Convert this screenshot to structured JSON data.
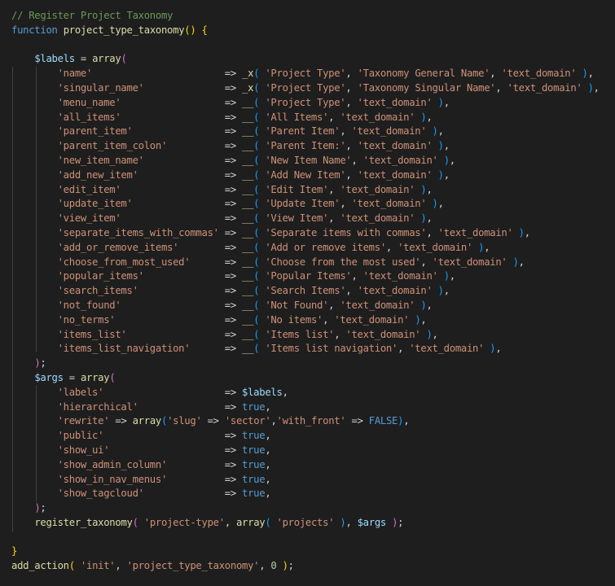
{
  "theme": {
    "background": "#1e1e1e",
    "colors": {
      "c": "#6a9955",
      "k": "#569cd6",
      "f": "#dcdcaa",
      "v": "#9cdcfe",
      "s": "#ce9178",
      "o": "#d4d4d4",
      "n": "#b5cea8",
      "y": "#ffd700",
      "m": "#da70d6",
      "b": "#179fff"
    }
  },
  "code_lines": [
    [
      [
        "c",
        "// Register Project Taxonomy"
      ]
    ],
    [
      [
        "k",
        "function "
      ],
      [
        "f",
        "project_type_taxonomy"
      ],
      [
        "y",
        "()"
      ],
      [
        "o",
        " "
      ],
      [
        "y",
        "{"
      ]
    ],
    [],
    [
      [
        "o",
        "    "
      ],
      [
        "v",
        "$labels"
      ],
      [
        "o",
        " = "
      ],
      [
        "f",
        "array"
      ],
      [
        "m",
        "("
      ]
    ],
    [
      [
        "o",
        "        "
      ],
      [
        "s",
        "'name'"
      ],
      [
        "o",
        "                       => "
      ],
      [
        "f",
        "_x"
      ],
      [
        "b",
        "("
      ],
      [
        "o",
        " "
      ],
      [
        "s",
        "'Project Type'"
      ],
      [
        "o",
        ", "
      ],
      [
        "s",
        "'Taxonomy General Name'"
      ],
      [
        "o",
        ", "
      ],
      [
        "s",
        "'text_domain'"
      ],
      [
        "o",
        " "
      ],
      [
        "b",
        ")"
      ],
      [
        "o",
        ","
      ]
    ],
    [
      [
        "o",
        "        "
      ],
      [
        "s",
        "'singular_name'"
      ],
      [
        "o",
        "              => "
      ],
      [
        "f",
        "_x"
      ],
      [
        "b",
        "("
      ],
      [
        "o",
        " "
      ],
      [
        "s",
        "'Project Type'"
      ],
      [
        "o",
        ", "
      ],
      [
        "s",
        "'Taxonomy Singular Name'"
      ],
      [
        "o",
        ", "
      ],
      [
        "s",
        "'text_domain'"
      ],
      [
        "o",
        " "
      ],
      [
        "b",
        ")"
      ],
      [
        "o",
        ","
      ]
    ],
    [
      [
        "o",
        "        "
      ],
      [
        "s",
        "'menu_name'"
      ],
      [
        "o",
        "                  => "
      ],
      [
        "f",
        "__"
      ],
      [
        "b",
        "("
      ],
      [
        "o",
        " "
      ],
      [
        "s",
        "'Project Type'"
      ],
      [
        "o",
        ", "
      ],
      [
        "s",
        "'text_domain'"
      ],
      [
        "o",
        " "
      ],
      [
        "b",
        ")"
      ],
      [
        "o",
        ","
      ]
    ],
    [
      [
        "o",
        "        "
      ],
      [
        "s",
        "'all_items'"
      ],
      [
        "o",
        "                  => "
      ],
      [
        "f",
        "__"
      ],
      [
        "b",
        "("
      ],
      [
        "o",
        " "
      ],
      [
        "s",
        "'All Items'"
      ],
      [
        "o",
        ", "
      ],
      [
        "s",
        "'text_domain'"
      ],
      [
        "o",
        " "
      ],
      [
        "b",
        ")"
      ],
      [
        "o",
        ","
      ]
    ],
    [
      [
        "o",
        "        "
      ],
      [
        "s",
        "'parent_item'"
      ],
      [
        "o",
        "                => "
      ],
      [
        "f",
        "__"
      ],
      [
        "b",
        "("
      ],
      [
        "o",
        " "
      ],
      [
        "s",
        "'Parent Item'"
      ],
      [
        "o",
        ", "
      ],
      [
        "s",
        "'text_domain'"
      ],
      [
        "o",
        " "
      ],
      [
        "b",
        ")"
      ],
      [
        "o",
        ","
      ]
    ],
    [
      [
        "o",
        "        "
      ],
      [
        "s",
        "'parent_item_colon'"
      ],
      [
        "o",
        "          => "
      ],
      [
        "f",
        "__"
      ],
      [
        "b",
        "("
      ],
      [
        "o",
        " "
      ],
      [
        "s",
        "'Parent Item:'"
      ],
      [
        "o",
        ", "
      ],
      [
        "s",
        "'text_domain'"
      ],
      [
        "o",
        " "
      ],
      [
        "b",
        ")"
      ],
      [
        "o",
        ","
      ]
    ],
    [
      [
        "o",
        "        "
      ],
      [
        "s",
        "'new_item_name'"
      ],
      [
        "o",
        "              => "
      ],
      [
        "f",
        "__"
      ],
      [
        "b",
        "("
      ],
      [
        "o",
        " "
      ],
      [
        "s",
        "'New Item Name'"
      ],
      [
        "o",
        ", "
      ],
      [
        "s",
        "'text_domain'"
      ],
      [
        "o",
        " "
      ],
      [
        "b",
        ")"
      ],
      [
        "o",
        ","
      ]
    ],
    [
      [
        "o",
        "        "
      ],
      [
        "s",
        "'add_new_item'"
      ],
      [
        "o",
        "               => "
      ],
      [
        "f",
        "__"
      ],
      [
        "b",
        "("
      ],
      [
        "o",
        " "
      ],
      [
        "s",
        "'Add New Item'"
      ],
      [
        "o",
        ", "
      ],
      [
        "s",
        "'text_domain'"
      ],
      [
        "o",
        " "
      ],
      [
        "b",
        ")"
      ],
      [
        "o",
        ","
      ]
    ],
    [
      [
        "o",
        "        "
      ],
      [
        "s",
        "'edit_item'"
      ],
      [
        "o",
        "                  => "
      ],
      [
        "f",
        "__"
      ],
      [
        "b",
        "("
      ],
      [
        "o",
        " "
      ],
      [
        "s",
        "'Edit Item'"
      ],
      [
        "o",
        ", "
      ],
      [
        "s",
        "'text_domain'"
      ],
      [
        "o",
        " "
      ],
      [
        "b",
        ")"
      ],
      [
        "o",
        ","
      ]
    ],
    [
      [
        "o",
        "        "
      ],
      [
        "s",
        "'update_item'"
      ],
      [
        "o",
        "                => "
      ],
      [
        "f",
        "__"
      ],
      [
        "b",
        "("
      ],
      [
        "o",
        " "
      ],
      [
        "s",
        "'Update Item'"
      ],
      [
        "o",
        ", "
      ],
      [
        "s",
        "'text_domain'"
      ],
      [
        "o",
        " "
      ],
      [
        "b",
        ")"
      ],
      [
        "o",
        ","
      ]
    ],
    [
      [
        "o",
        "        "
      ],
      [
        "s",
        "'view_item'"
      ],
      [
        "o",
        "                  => "
      ],
      [
        "f",
        "__"
      ],
      [
        "b",
        "("
      ],
      [
        "o",
        " "
      ],
      [
        "s",
        "'View Item'"
      ],
      [
        "o",
        ", "
      ],
      [
        "s",
        "'text_domain'"
      ],
      [
        "o",
        " "
      ],
      [
        "b",
        ")"
      ],
      [
        "o",
        ","
      ]
    ],
    [
      [
        "o",
        "        "
      ],
      [
        "s",
        "'separate_items_with_commas'"
      ],
      [
        "o",
        " => "
      ],
      [
        "f",
        "__"
      ],
      [
        "b",
        "("
      ],
      [
        "o",
        " "
      ],
      [
        "s",
        "'Separate items with commas'"
      ],
      [
        "o",
        ", "
      ],
      [
        "s",
        "'text_domain'"
      ],
      [
        "o",
        " "
      ],
      [
        "b",
        ")"
      ],
      [
        "o",
        ","
      ]
    ],
    [
      [
        "o",
        "        "
      ],
      [
        "s",
        "'add_or_remove_items'"
      ],
      [
        "o",
        "        => "
      ],
      [
        "f",
        "__"
      ],
      [
        "b",
        "("
      ],
      [
        "o",
        " "
      ],
      [
        "s",
        "'Add or remove items'"
      ],
      [
        "o",
        ", "
      ],
      [
        "s",
        "'text_domain'"
      ],
      [
        "o",
        " "
      ],
      [
        "b",
        ")"
      ],
      [
        "o",
        ","
      ]
    ],
    [
      [
        "o",
        "        "
      ],
      [
        "s",
        "'choose_from_most_used'"
      ],
      [
        "o",
        "      => "
      ],
      [
        "f",
        "__"
      ],
      [
        "b",
        "("
      ],
      [
        "o",
        " "
      ],
      [
        "s",
        "'Choose from the most used'"
      ],
      [
        "o",
        ", "
      ],
      [
        "s",
        "'text_domain'"
      ],
      [
        "o",
        " "
      ],
      [
        "b",
        ")"
      ],
      [
        "o",
        ","
      ]
    ],
    [
      [
        "o",
        "        "
      ],
      [
        "s",
        "'popular_items'"
      ],
      [
        "o",
        "              => "
      ],
      [
        "f",
        "__"
      ],
      [
        "b",
        "("
      ],
      [
        "o",
        " "
      ],
      [
        "s",
        "'Popular Items'"
      ],
      [
        "o",
        ", "
      ],
      [
        "s",
        "'text_domain'"
      ],
      [
        "o",
        " "
      ],
      [
        "b",
        ")"
      ],
      [
        "o",
        ","
      ]
    ],
    [
      [
        "o",
        "        "
      ],
      [
        "s",
        "'search_items'"
      ],
      [
        "o",
        "               => "
      ],
      [
        "f",
        "__"
      ],
      [
        "b",
        "("
      ],
      [
        "o",
        " "
      ],
      [
        "s",
        "'Search Items'"
      ],
      [
        "o",
        ", "
      ],
      [
        "s",
        "'text_domain'"
      ],
      [
        "o",
        " "
      ],
      [
        "b",
        ")"
      ],
      [
        "o",
        ","
      ]
    ],
    [
      [
        "o",
        "        "
      ],
      [
        "s",
        "'not_found'"
      ],
      [
        "o",
        "                  => "
      ],
      [
        "f",
        "__"
      ],
      [
        "b",
        "("
      ],
      [
        "o",
        " "
      ],
      [
        "s",
        "'Not Found'"
      ],
      [
        "o",
        ", "
      ],
      [
        "s",
        "'text_domain'"
      ],
      [
        "o",
        " "
      ],
      [
        "b",
        ")"
      ],
      [
        "o",
        ","
      ]
    ],
    [
      [
        "o",
        "        "
      ],
      [
        "s",
        "'no_terms'"
      ],
      [
        "o",
        "                   => "
      ],
      [
        "f",
        "__"
      ],
      [
        "b",
        "("
      ],
      [
        "o",
        " "
      ],
      [
        "s",
        "'No items'"
      ],
      [
        "o",
        ", "
      ],
      [
        "s",
        "'text_domain'"
      ],
      [
        "o",
        " "
      ],
      [
        "b",
        ")"
      ],
      [
        "o",
        ","
      ]
    ],
    [
      [
        "o",
        "        "
      ],
      [
        "s",
        "'items_list'"
      ],
      [
        "o",
        "                 => "
      ],
      [
        "f",
        "__"
      ],
      [
        "b",
        "("
      ],
      [
        "o",
        " "
      ],
      [
        "s",
        "'Items list'"
      ],
      [
        "o",
        ", "
      ],
      [
        "s",
        "'text_domain'"
      ],
      [
        "o",
        " "
      ],
      [
        "b",
        ")"
      ],
      [
        "o",
        ","
      ]
    ],
    [
      [
        "o",
        "        "
      ],
      [
        "s",
        "'items_list_navigation'"
      ],
      [
        "o",
        "      => "
      ],
      [
        "f",
        "__"
      ],
      [
        "b",
        "("
      ],
      [
        "o",
        " "
      ],
      [
        "s",
        "'Items list navigation'"
      ],
      [
        "o",
        ", "
      ],
      [
        "s",
        "'text_domain'"
      ],
      [
        "o",
        " "
      ],
      [
        "b",
        ")"
      ],
      [
        "o",
        ","
      ]
    ],
    [
      [
        "o",
        "    "
      ],
      [
        "m",
        ")"
      ],
      [
        "o",
        ";"
      ]
    ],
    [
      [
        "o",
        "    "
      ],
      [
        "v",
        "$args"
      ],
      [
        "o",
        " = "
      ],
      [
        "f",
        "array"
      ],
      [
        "m",
        "("
      ]
    ],
    [
      [
        "o",
        "        "
      ],
      [
        "s",
        "'labels'"
      ],
      [
        "o",
        "                     => "
      ],
      [
        "v",
        "$labels"
      ],
      [
        "o",
        ","
      ]
    ],
    [
      [
        "o",
        "        "
      ],
      [
        "s",
        "'hierarchical'"
      ],
      [
        "o",
        "               => "
      ],
      [
        "k",
        "true"
      ],
      [
        "o",
        ","
      ]
    ],
    [
      [
        "o",
        "        "
      ],
      [
        "s",
        "'rewrite'"
      ],
      [
        "o",
        " => "
      ],
      [
        "f",
        "array"
      ],
      [
        "b",
        "("
      ],
      [
        "s",
        "'slug'"
      ],
      [
        "o",
        " => "
      ],
      [
        "s",
        "'sector'"
      ],
      [
        "o",
        ","
      ],
      [
        "s",
        "'with_front'"
      ],
      [
        "o",
        " => "
      ],
      [
        "k",
        "FALSE"
      ],
      [
        "b",
        ")"
      ],
      [
        "o",
        ","
      ]
    ],
    [
      [
        "o",
        "        "
      ],
      [
        "s",
        "'public'"
      ],
      [
        "o",
        "                     => "
      ],
      [
        "k",
        "true"
      ],
      [
        "o",
        ","
      ]
    ],
    [
      [
        "o",
        "        "
      ],
      [
        "s",
        "'show_ui'"
      ],
      [
        "o",
        "                    => "
      ],
      [
        "k",
        "true"
      ],
      [
        "o",
        ","
      ]
    ],
    [
      [
        "o",
        "        "
      ],
      [
        "s",
        "'show_admin_column'"
      ],
      [
        "o",
        "          => "
      ],
      [
        "k",
        "true"
      ],
      [
        "o",
        ","
      ]
    ],
    [
      [
        "o",
        "        "
      ],
      [
        "s",
        "'show_in_nav_menus'"
      ],
      [
        "o",
        "          => "
      ],
      [
        "k",
        "true"
      ],
      [
        "o",
        ","
      ]
    ],
    [
      [
        "o",
        "        "
      ],
      [
        "s",
        "'show_tagcloud'"
      ],
      [
        "o",
        "              => "
      ],
      [
        "k",
        "true"
      ],
      [
        "o",
        ","
      ]
    ],
    [
      [
        "o",
        "    "
      ],
      [
        "m",
        ")"
      ],
      [
        "o",
        ";"
      ]
    ],
    [
      [
        "o",
        "    "
      ],
      [
        "f",
        "register_taxonomy"
      ],
      [
        "m",
        "("
      ],
      [
        "o",
        " "
      ],
      [
        "s",
        "'project-type'"
      ],
      [
        "o",
        ", "
      ],
      [
        "f",
        "array"
      ],
      [
        "b",
        "("
      ],
      [
        "o",
        " "
      ],
      [
        "s",
        "'projects'"
      ],
      [
        "o",
        " "
      ],
      [
        "b",
        ")"
      ],
      [
        "o",
        ", "
      ],
      [
        "v",
        "$args"
      ],
      [
        "o",
        " "
      ],
      [
        "m",
        ")"
      ],
      [
        "o",
        ";"
      ]
    ],
    [],
    [
      [
        "y",
        "}"
      ]
    ],
    [
      [
        "f",
        "add_action"
      ],
      [
        "y",
        "("
      ],
      [
        "o",
        " "
      ],
      [
        "s",
        "'init'"
      ],
      [
        "o",
        ", "
      ],
      [
        "s",
        "'project_type_taxonomy'"
      ],
      [
        "o",
        ", "
      ],
      [
        "n",
        "0"
      ],
      [
        "o",
        " "
      ],
      [
        "y",
        ")"
      ],
      [
        "o",
        ";"
      ]
    ]
  ]
}
